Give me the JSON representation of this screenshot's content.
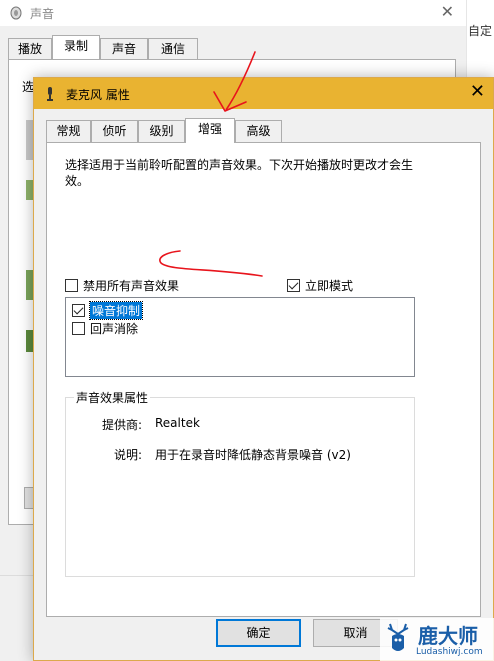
{
  "back_window": {
    "title": "声音",
    "tabs": [
      "播放",
      "录制",
      "声音",
      "通信"
    ],
    "active_tab_index": 1,
    "panel_label": "选",
    "edge_text": "自定"
  },
  "dialog": {
    "title": "麦克风 属性",
    "tabs": [
      "常规",
      "侦听",
      "级别",
      "增强",
      "高级"
    ],
    "active_tab_index": 3,
    "description": "选择适用于当前聆听配置的声音效果。下次开始播放时更改才会生效。",
    "disable_all": {
      "label": "禁用所有声音效果",
      "checked": false
    },
    "immediate_mode": {
      "label": "立即模式",
      "checked": true
    },
    "effects": [
      {
        "label": "噪音抑制",
        "checked": true,
        "selected": true
      },
      {
        "label": "回声消除",
        "checked": false,
        "selected": false
      }
    ],
    "properties": {
      "title": "声音效果属性",
      "provider_label": "提供商:",
      "provider_value": "Realtek",
      "description_label": "说明:",
      "description_value": "用于在录音时降低静态背景噪音 (v2)"
    },
    "buttons": {
      "ok": "确定",
      "cancel": "取消"
    }
  },
  "watermark": {
    "brand": "鹿大师",
    "url": "Ludashiwj.com"
  },
  "colors": {
    "title_bar": "#e9b331",
    "selection": "#0078d7",
    "annotation": "#e8141c"
  }
}
